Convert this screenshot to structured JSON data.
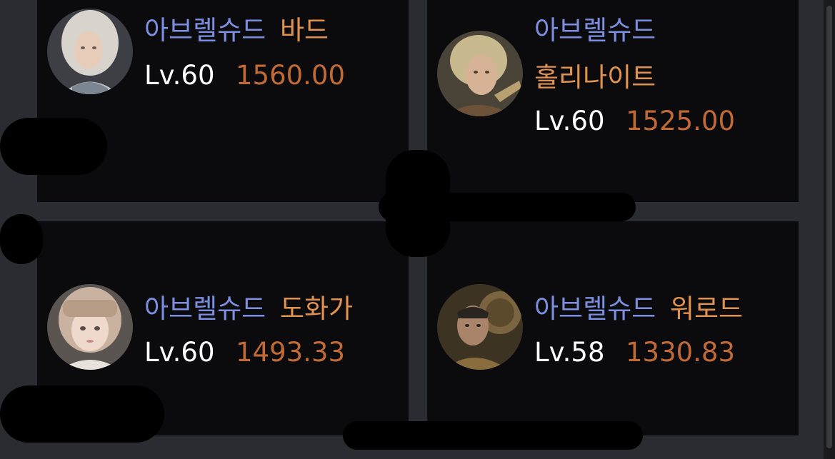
{
  "characters": [
    {
      "server": "아브렐슈드",
      "class_name": "바드",
      "level": "Lv.60",
      "item_level": "1560.00",
      "avatar_icon": "bard-portrait-icon"
    },
    {
      "server": "아브렐슈드",
      "class_name": "홀리나이트",
      "level": "Lv.60",
      "item_level": "1525.00",
      "avatar_icon": "holyknight-portrait-icon"
    },
    {
      "server": "아브렐슈드",
      "class_name": "도화가",
      "level": "Lv.60",
      "item_level": "1493.33",
      "avatar_icon": "artist-portrait-icon"
    },
    {
      "server": "아브렐슈드",
      "class_name": "워로드",
      "level": "Lv.58",
      "item_level": "1330.83",
      "avatar_icon": "warlord-portrait-icon"
    }
  ],
  "colors": {
    "server": "#7c8fe0",
    "class_name": "#e2924f",
    "level": "#ffffff",
    "item_level": "#c16a36",
    "panel": "#0b0b0e",
    "background": "#2b2c31"
  }
}
